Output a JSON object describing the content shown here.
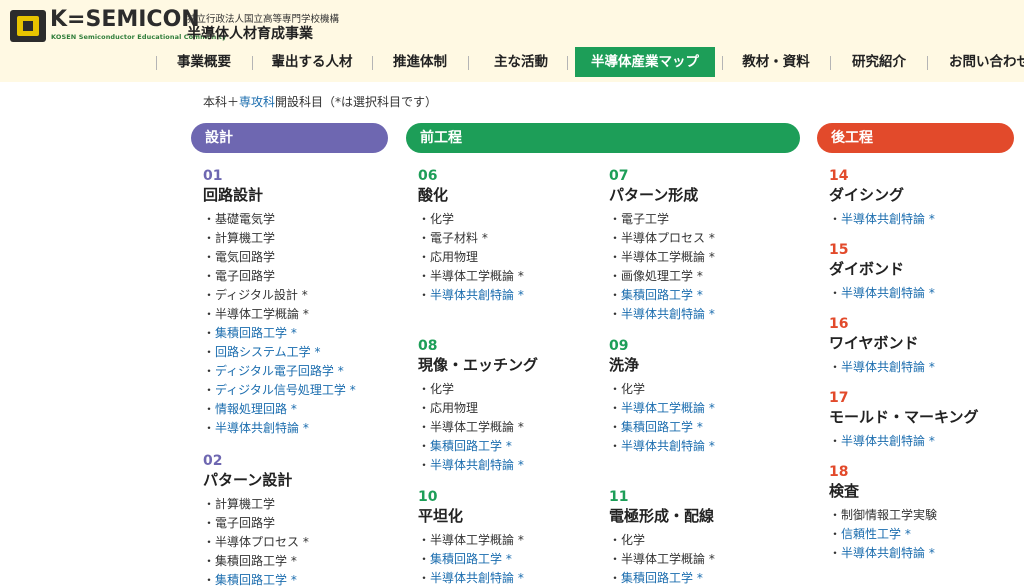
{
  "header": {
    "logo_text": "K=SEMICON",
    "logo_sub": "KOSEN Semiconductor Educational Community",
    "org_small": "独立行政法人国立高等専門学校機構",
    "org_title": "半導体人材育成事業"
  },
  "nav": [
    {
      "label": "事業概要"
    },
    {
      "label": "輩出する人材"
    },
    {
      "label": "推進体制"
    },
    {
      "label": "主な活動"
    },
    {
      "label": "半導体産業マップ",
      "active": true
    },
    {
      "label": "教材・資料"
    },
    {
      "label": "研究紹介"
    },
    {
      "label": "お問い合わせ"
    }
  ],
  "intro": {
    "prefix": "本科＋",
    "link": "専攻科",
    "suffix": "開設科目（*は選択科目です）"
  },
  "categories": {
    "design": "設計",
    "front": "前工程",
    "back": "後工程"
  },
  "sections": [
    {
      "id": "s01",
      "num": "01",
      "title": "回路設計",
      "items": [
        {
          "t": "基礎電気学"
        },
        {
          "t": "計算機工学"
        },
        {
          "t": "電気回路学"
        },
        {
          "t": "電子回路学"
        },
        {
          "t": "ディジタル設計 *"
        },
        {
          "t": "半導体工学概論 *"
        },
        {
          "t": "集積回路工学 *",
          "link": true
        },
        {
          "t": "回路システム工学 *",
          "link": true
        },
        {
          "t": "ディジタル電子回路学 *",
          "link": true
        },
        {
          "t": "ディジタル信号処理工学 *",
          "link": true
        },
        {
          "t": "情報処理回路 *",
          "link": true
        },
        {
          "t": "半導体共創特論 *",
          "link": true
        }
      ]
    },
    {
      "id": "s02",
      "num": "02",
      "title": "パターン設計",
      "items": [
        {
          "t": "計算機工学"
        },
        {
          "t": "電子回路学"
        },
        {
          "t": "半導体プロセス *"
        },
        {
          "t": "集積回路工学 *"
        },
        {
          "t": "集積回路工学 *",
          "link": true
        }
      ]
    },
    {
      "id": "s06",
      "num": "06",
      "title": "酸化",
      "items": [
        {
          "t": "化学"
        },
        {
          "t": "電子材料 *"
        },
        {
          "t": "応用物理"
        },
        {
          "t": "半導体工学概論 *"
        },
        {
          "t": "半導体共創特論 *",
          "link": true
        }
      ]
    },
    {
      "id": "s07",
      "num": "07",
      "title": "パターン形成",
      "items": [
        {
          "t": "電子工学"
        },
        {
          "t": "半導体プロセス *"
        },
        {
          "t": "半導体工学概論 *"
        },
        {
          "t": "画像処理工学 *"
        },
        {
          "t": "集積回路工学 *",
          "link": true
        },
        {
          "t": "半導体共創特論 *",
          "link": true
        }
      ]
    },
    {
      "id": "s08",
      "num": "08",
      "title": "現像・エッチング",
      "items": [
        {
          "t": "化学"
        },
        {
          "t": "応用物理"
        },
        {
          "t": "半導体工学概論 *"
        },
        {
          "t": "集積回路工学 *",
          "link": true
        },
        {
          "t": "半導体共創特論 *",
          "link": true
        }
      ]
    },
    {
      "id": "s09",
      "num": "09",
      "title": "洗浄",
      "items": [
        {
          "t": "化学"
        },
        {
          "t": "半導体工学概論 *",
          "link": true
        },
        {
          "t": "集積回路工学 *",
          "link": true
        },
        {
          "t": "半導体共創特論 *",
          "link": true
        }
      ]
    },
    {
      "id": "s10",
      "num": "10",
      "title": "平坦化",
      "items": [
        {
          "t": "半導体工学概論 *"
        },
        {
          "t": "集積回路工学 *",
          "link": true
        },
        {
          "t": "半導体共創特論 *",
          "link": true
        }
      ]
    },
    {
      "id": "s11",
      "num": "11",
      "title": "電極形成・配線",
      "items": [
        {
          "t": "化学"
        },
        {
          "t": "半導体工学概論 *"
        },
        {
          "t": "集積回路工学 *",
          "link": true
        }
      ]
    },
    {
      "id": "s14",
      "num": "14",
      "title": "ダイシング",
      "items": [
        {
          "t": "半導体共創特論 *",
          "link": true
        }
      ]
    },
    {
      "id": "s15",
      "num": "15",
      "title": "ダイボンド",
      "items": [
        {
          "t": "半導体共創特論 *",
          "link": true
        }
      ]
    },
    {
      "id": "s16",
      "num": "16",
      "title": "ワイヤボンド",
      "items": [
        {
          "t": "半導体共創特論 *",
          "link": true
        }
      ]
    },
    {
      "id": "s17",
      "num": "17",
      "title": "モールド・マーキング",
      "items": [
        {
          "t": "半導体共創特論 *",
          "link": true
        }
      ]
    },
    {
      "id": "s18",
      "num": "18",
      "title": "検査",
      "items": [
        {
          "t": "制御情報工学実験"
        },
        {
          "t": "信頼性工学 *",
          "link": true
        },
        {
          "t": "半導体共創特論 *",
          "link": true
        }
      ]
    }
  ]
}
